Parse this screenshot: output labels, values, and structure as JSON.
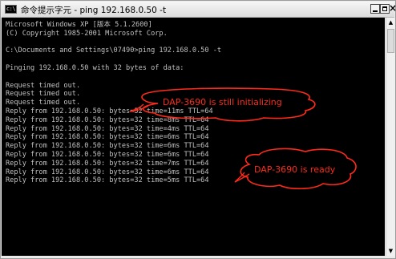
{
  "window": {
    "title": "命令提示字元 - ping 192.168.0.50 -t",
    "icon_label": "c:\\",
    "icons": {
      "app": "console-icon",
      "minimize": "minimize-icon",
      "maximize": "maximize-icon",
      "close": "close-icon"
    },
    "close_glyph": "×"
  },
  "console": {
    "lines": [
      "Microsoft Windows XP [版本 5.1.2600]",
      "(C) Copyright 1985-2001 Microsoft Corp.",
      "",
      "C:\\Documents and Settings\\07490>ping 192.168.0.50 -t",
      "",
      "Pinging 192.168.0.50 with 32 bytes of data:",
      "",
      "Request timed out.",
      "Request timed out.",
      "Request timed out.",
      "Reply from 192.168.0.50: bytes=32 time=11ms TTL=64",
      "Reply from 192.168.0.50: bytes=32 time=8ms TTL=64",
      "Reply from 192.168.0.50: bytes=32 time=4ms TTL=64",
      "Reply from 192.168.0.50: bytes=32 time=6ms TTL=64",
      "Reply from 192.168.0.50: bytes=32 time=6ms TTL=64",
      "Reply from 192.168.0.50: bytes=32 time=6ms TTL=64",
      "Reply from 192.168.0.50: bytes=32 time=7ms TTL=64",
      "Reply from 192.168.0.50: bytes=32 time=6ms TTL=64",
      "Reply from 192.168.0.50: bytes=32 time=5ms TTL=64"
    ],
    "text_color": "#c0c0c0",
    "background": "#000000"
  },
  "annotations": {
    "initializing": "DAP-3690 is still initializing",
    "ready": "DAP-3690 is ready",
    "color": "#ff2a1a"
  },
  "scrollbar": {
    "up_glyph": "▲",
    "down_glyph": "▼"
  }
}
